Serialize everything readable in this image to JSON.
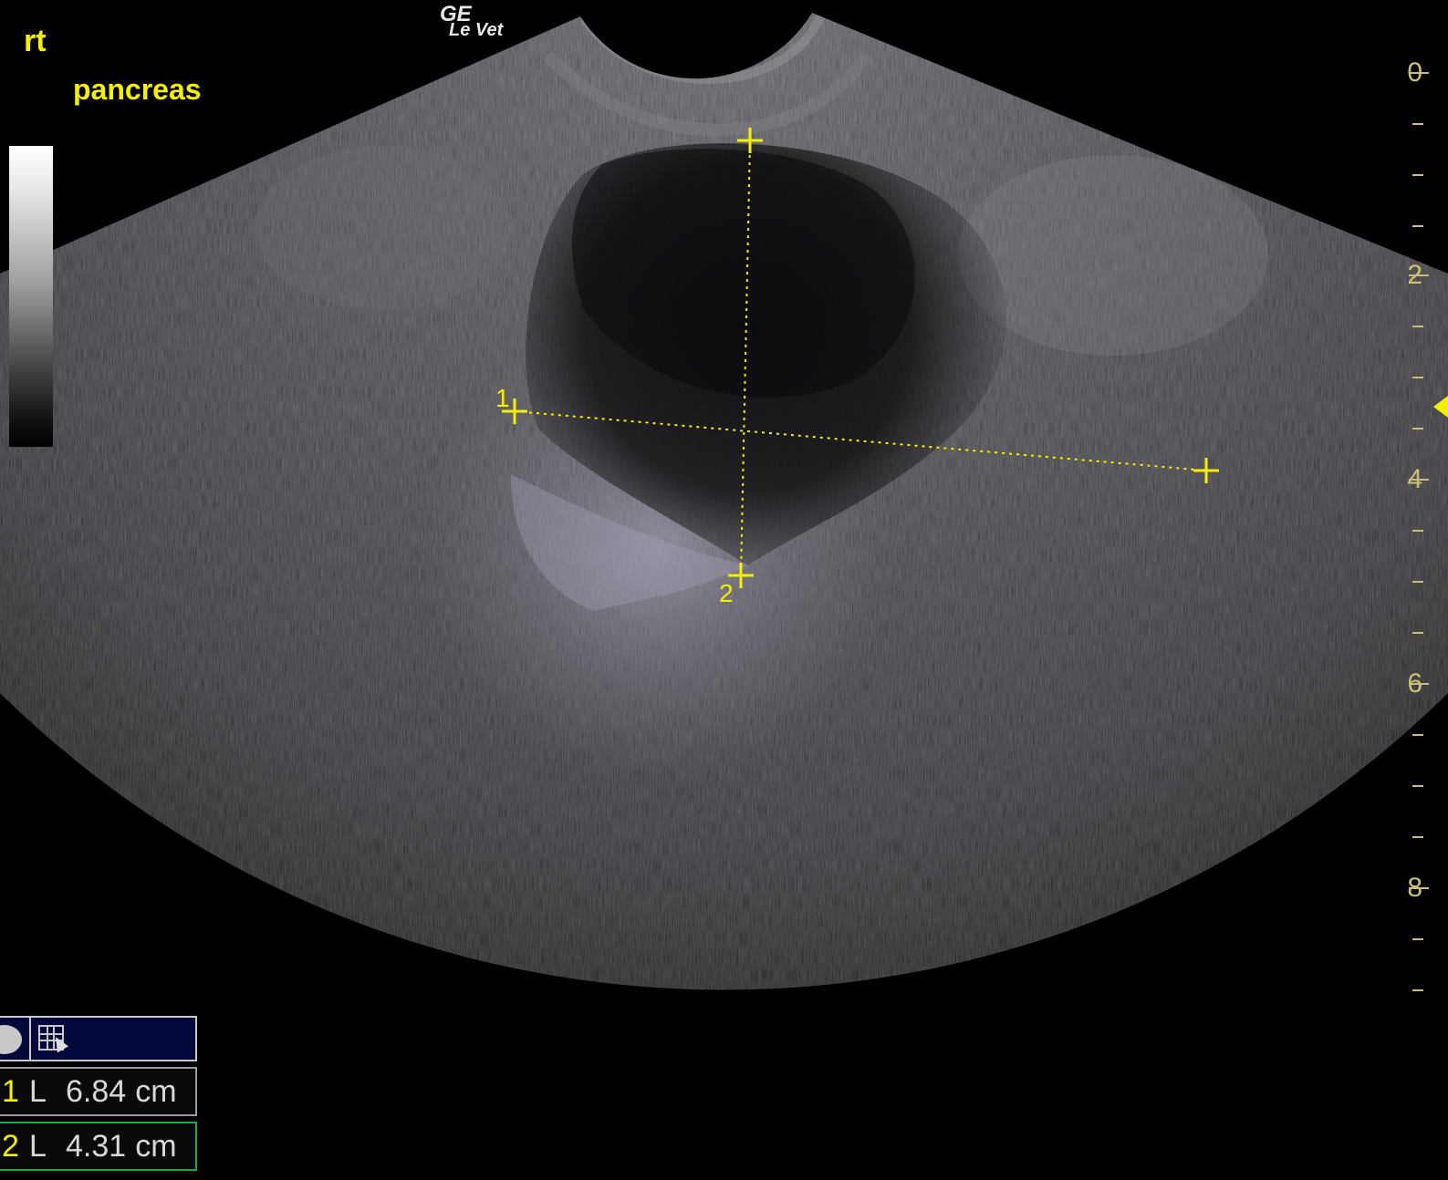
{
  "overlay": {
    "side_label": "rt",
    "organ_label": "pancreas",
    "brand_logo": "GE",
    "brand_model": "Le Vet"
  },
  "depth_scale": {
    "labels": [
      "0",
      "2",
      "4",
      "6",
      "8"
    ],
    "unit": "cm",
    "color": "#cbbf78"
  },
  "calipers": {
    "color": "#f4f000",
    "items": [
      {
        "index": "1"
      },
      {
        "index": "2"
      }
    ]
  },
  "measurements": {
    "rows": [
      {
        "index": "1",
        "type": "L",
        "value": "6.84",
        "unit": "cm",
        "active": false
      },
      {
        "index": "2",
        "type": "L",
        "value": "4.31",
        "unit": "cm",
        "active": true
      }
    ]
  },
  "toolbar": {
    "icons": [
      "record-icon",
      "grid-icon",
      "cursor-icon"
    ]
  }
}
